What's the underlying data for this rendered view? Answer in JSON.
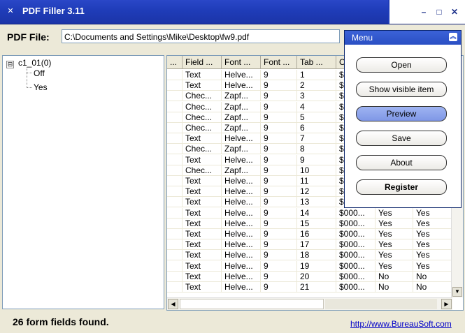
{
  "window": {
    "title": "PDF Filler 3.11",
    "app_icon": "app-icon",
    "controls": {
      "minimize": "–",
      "maximize": "□",
      "close": "✕"
    }
  },
  "file_row": {
    "label": "PDF File:",
    "value": "C:\\Documents and Settings\\Mike\\Desktop\\fw9.pdf"
  },
  "tree": {
    "expander": "⊟",
    "root": "c1_01(0)",
    "children": [
      "Off",
      "Yes"
    ]
  },
  "grid": {
    "columns": [
      "...",
      "Field ...",
      "Font ...",
      "Font ...",
      "Tab ...",
      "C",
      "",
      ""
    ],
    "rows": [
      [
        "",
        "Text",
        "Helve...",
        "9",
        "1",
        "$",
        "",
        ""
      ],
      [
        "",
        "Text",
        "Helve...",
        "9",
        "2",
        "$",
        "",
        ""
      ],
      [
        "",
        "Chec...",
        "Zapf...",
        "9",
        "3",
        "$",
        "",
        ""
      ],
      [
        "",
        "Chec...",
        "Zapf...",
        "9",
        "4",
        "$",
        "",
        ""
      ],
      [
        "",
        "Chec...",
        "Zapf...",
        "9",
        "5",
        "$",
        "",
        ""
      ],
      [
        "",
        "Chec...",
        "Zapf...",
        "9",
        "6",
        "$",
        "",
        ""
      ],
      [
        "",
        "Text",
        "Helve...",
        "9",
        "7",
        "$",
        "",
        ""
      ],
      [
        "",
        "Chec...",
        "Zapf...",
        "9",
        "8",
        "$",
        "",
        ""
      ],
      [
        "",
        "Text",
        "Helve...",
        "9",
        "9",
        "$",
        "",
        ""
      ],
      [
        "",
        "Chec...",
        "Zapf...",
        "9",
        "10",
        "$",
        "",
        ""
      ],
      [
        "",
        "Text",
        "Helve...",
        "9",
        "11",
        "$",
        "",
        ""
      ],
      [
        "",
        "Text",
        "Helve...",
        "9",
        "12",
        "$",
        "",
        ""
      ],
      [
        "",
        "Text",
        "Helve...",
        "9",
        "13",
        "$",
        "",
        ""
      ],
      [
        "",
        "Text",
        "Helve...",
        "9",
        "14",
        "$000...",
        "Yes",
        "Yes"
      ],
      [
        "",
        "Text",
        "Helve...",
        "9",
        "15",
        "$000...",
        "Yes",
        "Yes"
      ],
      [
        "",
        "Text",
        "Helve...",
        "9",
        "16",
        "$000...",
        "Yes",
        "Yes"
      ],
      [
        "",
        "Text",
        "Helve...",
        "9",
        "17",
        "$000...",
        "Yes",
        "Yes"
      ],
      [
        "",
        "Text",
        "Helve...",
        "9",
        "18",
        "$000...",
        "Yes",
        "Yes"
      ],
      [
        "",
        "Text",
        "Helve...",
        "9",
        "19",
        "$000...",
        "Yes",
        "Yes"
      ],
      [
        "",
        "Text",
        "Helve...",
        "9",
        "20",
        "$000...",
        "No",
        "No"
      ],
      [
        "",
        "Text",
        "Helve...",
        "9",
        "21",
        "$000...",
        "No",
        "No"
      ]
    ]
  },
  "menu": {
    "title": "Menu",
    "collapse_icon": "collapse-icon",
    "buttons": [
      {
        "label": "Open",
        "active": false,
        "bold": false
      },
      {
        "label": "Show visible item",
        "active": false,
        "bold": false
      },
      {
        "label": "Preview",
        "active": true,
        "bold": false
      },
      {
        "label": "Save",
        "active": false,
        "bold": false
      },
      {
        "label": "About",
        "active": false,
        "bold": false
      },
      {
        "label": "Register",
        "active": false,
        "bold": true
      }
    ]
  },
  "status": {
    "text": "26 form fields found.",
    "link": "http://www.BureauSoft.com"
  },
  "colors": {
    "titlebar": "#1f3cb8",
    "menu_header": "#2a4fc4",
    "active_button": "#8fa6ec",
    "link": "#0000c8"
  }
}
